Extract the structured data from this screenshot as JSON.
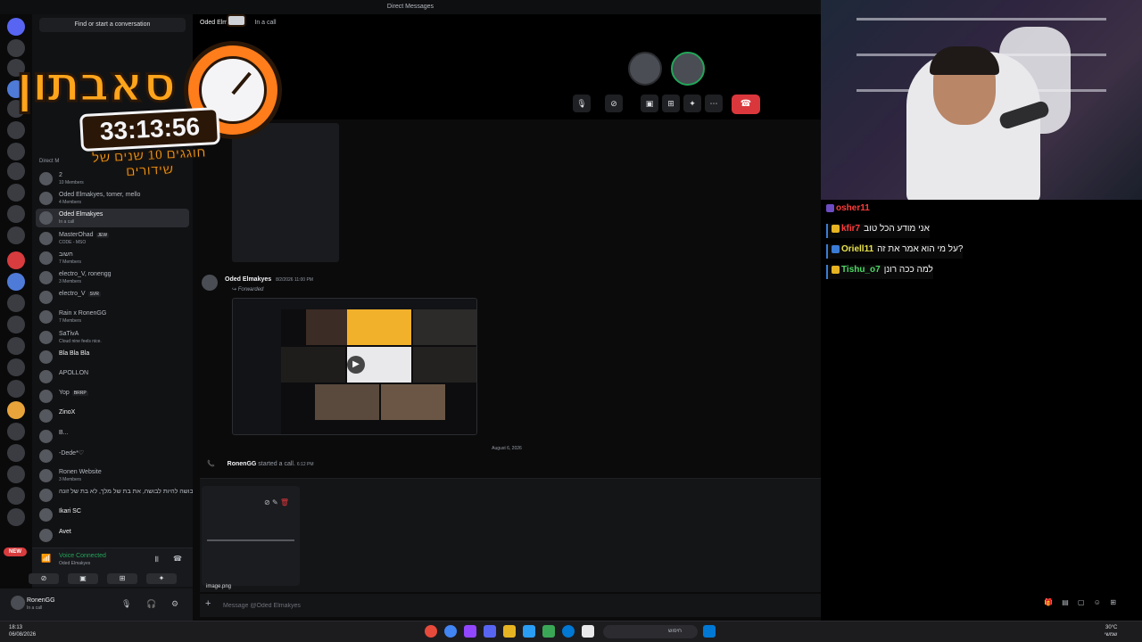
{
  "window": {
    "title": "Direct Messages"
  },
  "rail": {
    "new_badge": "NEW"
  },
  "sidebar": {
    "find_placeholder": "Find or start a conversation",
    "section_header": "Direct M",
    "items": [
      {
        "name": "2",
        "sub": "10 Members"
      },
      {
        "name": "Oded Elmakyes, tomer, mello",
        "sub": "4 Members"
      },
      {
        "name": "Oded Elmakyes",
        "sub": "In a call"
      },
      {
        "name": "MasterOhad",
        "tag": "JEW",
        "sub": "CODE - MSO"
      },
      {
        "name": "חשוב",
        "sub": "7 Members"
      },
      {
        "name": "electro_V, ronengg",
        "sub": "3 Members"
      },
      {
        "name": "electro_V",
        "tag": "SVR",
        "sub": ""
      },
      {
        "name": "Rain x RonenGG",
        "sub": "7 Members"
      },
      {
        "name": "SaTivA",
        "sub": "Cloud nine feels nice."
      },
      {
        "name": "Bla Bla Bla",
        "sub": ""
      },
      {
        "name": "APOLLON",
        "sub": ""
      },
      {
        "name": "Yop",
        "tag": "BRRP",
        "sub": ""
      },
      {
        "name": "ZinoX",
        "sub": ""
      },
      {
        "name": "B...",
        "sub": ""
      },
      {
        "name": "-Dede*♡",
        "sub": ""
      },
      {
        "name": "Ronen Website",
        "sub": "3 Members"
      },
      {
        "name": "לא בושה להיות לבושה, את בת של מלך, לא בת של זונה",
        "sub": ""
      },
      {
        "name": "Ikari SC",
        "sub": ""
      },
      {
        "name": "Avet",
        "sub": ""
      }
    ]
  },
  "voice": {
    "label": "Voice Connected",
    "channel": "Oded Elmakyes"
  },
  "user": {
    "name": "RonenGG",
    "status": "In a call"
  },
  "call": {
    "header_name": "Oded Elmakyes",
    "header_status": "In a call"
  },
  "messages": {
    "forward_author": "Oded Elmakyes",
    "forward_time": "8/2/2026 11:00 PM",
    "forwarded_label": "Forwarded",
    "date_divider": "August 6, 2026",
    "call_starter": "RonenGG",
    "call_started_text": "started a call.",
    "call_time": "6:12 PM"
  },
  "attachment": {
    "filename": "image.png"
  },
  "composer": {
    "placeholder": "Message @Oded Elmakyes"
  },
  "stream_chat": [
    {
      "user": "osher11",
      "text": "",
      "color": "#ff3b3b"
    },
    {
      "user": "kfir7",
      "text": "אני מודע הכל טוב",
      "color": "#ff3b3b"
    },
    {
      "user": "Oriell11",
      "text": "על מי הוא אמר את זה?",
      "color": "#e8e24a"
    },
    {
      "user": "Tishu_o7",
      "text": "למה ככה רונן",
      "color": "#4cd964"
    }
  ],
  "overlay": {
    "title": "סאבתון",
    "timer": "33:13:56",
    "subtitle": "חוגגים 10 שנים של שידורים"
  },
  "taskbar": {
    "time": "18:13",
    "date": "06/08/2026",
    "search_placeholder": "חיפוש",
    "weather_temp": "30°C",
    "weather_desc": "שמשי"
  }
}
